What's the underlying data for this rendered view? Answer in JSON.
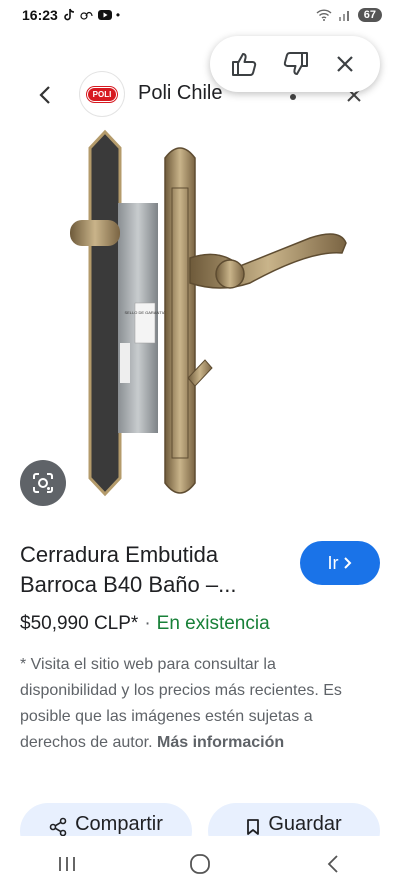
{
  "status_bar": {
    "time": "16:23",
    "battery": "67"
  },
  "header": {
    "site_name": "Poli Chile",
    "logo_text": "POLI"
  },
  "product": {
    "title": "Cerradura Embutida Barroca B40 Baño –...",
    "price": "$50,990 CLP*",
    "separator": "·",
    "availability": "En existencia",
    "go_label": "Ir",
    "label_sticker": "SELLO DE GARANTIA"
  },
  "disclaimer": {
    "text": "* Visita el sitio web para consultar la disponibilidad y los precios más recientes. Es posible que las imágenes estén sujetas a derechos de autor.",
    "more": "Más información"
  },
  "actions": {
    "share": "Compartir",
    "save": "Guardar"
  },
  "colors": {
    "accent": "#1a73e8",
    "stock": "#188038",
    "chip": "#e8f0fe",
    "brand": "#d71920"
  },
  "icons": [
    "thumbs-up-icon",
    "thumbs-down-icon",
    "close-icon",
    "back-arrow-icon",
    "lens-icon",
    "share-icon",
    "bookmark-icon",
    "chevron-right-icon"
  ]
}
